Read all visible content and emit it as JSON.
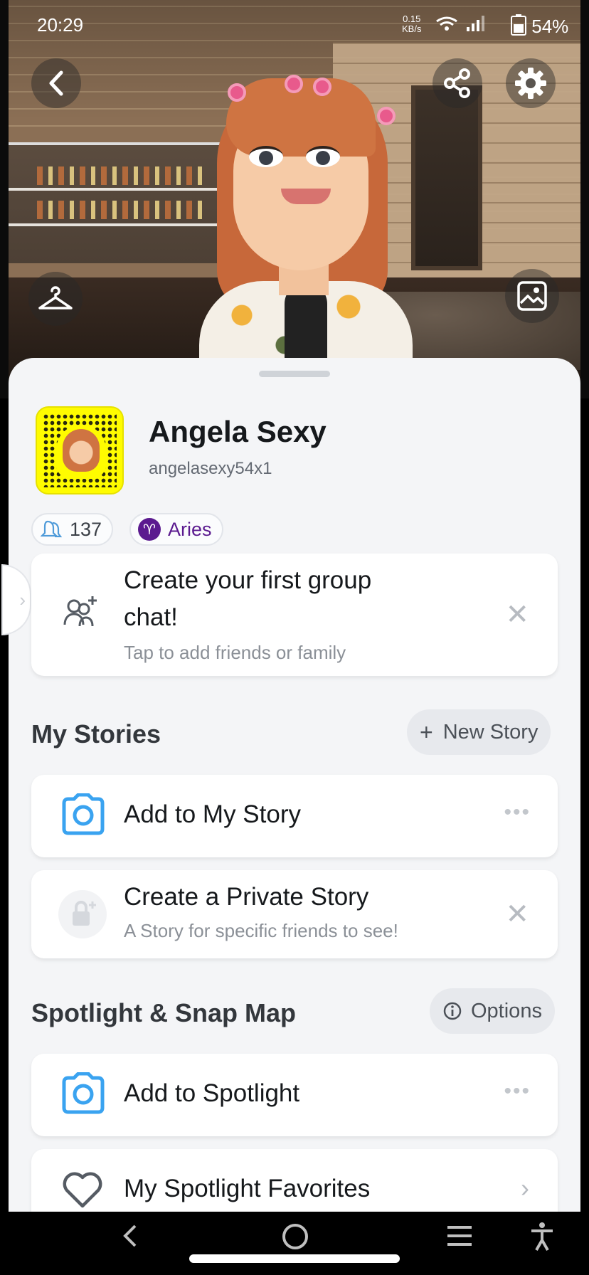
{
  "status_bar": {
    "time": "20:29",
    "net_speed_value": "0.15",
    "net_speed_unit": "KB/s",
    "battery": "54%"
  },
  "profile": {
    "display_name": "Angela Sexy",
    "username": "angelasexy54x1",
    "friend_count": "137",
    "zodiac": "Aries",
    "zodiac_symbol": "♈"
  },
  "group_chat_card": {
    "title_line1": "Create your first group",
    "title_line2": "chat!",
    "subtitle": "Tap to add friends or family"
  },
  "my_stories": {
    "title": "My Stories",
    "new_story_label": "New Story",
    "items": [
      {
        "label": "Add to My Story",
        "icon": "camera-icon"
      },
      {
        "label": "Create a Private Story",
        "subtitle": "A Story for specific friends to see!",
        "icon": "lock-plus-icon"
      }
    ]
  },
  "spotlight": {
    "title": "Spotlight & Snap Map",
    "options_label": "Options",
    "items": [
      {
        "label": "Add to Spotlight",
        "icon": "camera-icon"
      },
      {
        "label": "My Spotlight Favorites",
        "icon": "heart-icon"
      }
    ]
  },
  "colors": {
    "accent_blue": "#3aa3f0",
    "snap_yellow": "#fffc00",
    "zodiac_purple": "#5b1a8f",
    "sheet_bg": "#f4f5f7"
  }
}
